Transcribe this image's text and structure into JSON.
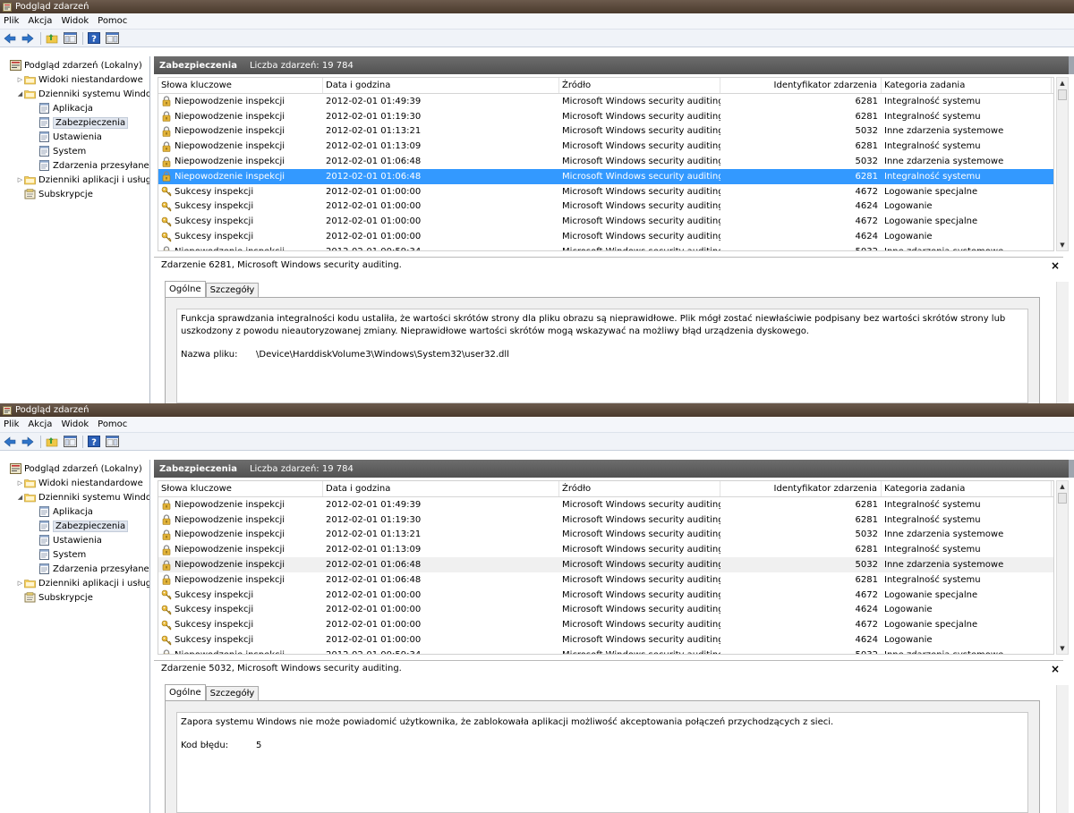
{
  "windows": [
    {
      "title": "Podgląd zdarzeń",
      "menu": [
        "Plik",
        "Akcja",
        "Widok",
        "Pomoc"
      ],
      "tree": [
        {
          "label": "Podgląd zdarzeń (Lokalny)",
          "twist": "",
          "level": 0,
          "icon": "event-viewer-icon"
        },
        {
          "label": "Widoki niestandardowe",
          "twist": "▷",
          "level": 1,
          "icon": "folder-icon"
        },
        {
          "label": "Dzienniki systemu Windows",
          "twist": "◢",
          "level": 1,
          "icon": "folder-icon"
        },
        {
          "label": "Aplikacja",
          "twist": "",
          "level": 2,
          "icon": "log-icon"
        },
        {
          "label": "Zabezpieczenia",
          "twist": "",
          "level": 2,
          "icon": "log-icon",
          "selected": true
        },
        {
          "label": "Ustawienia",
          "twist": "",
          "level": 2,
          "icon": "log-icon"
        },
        {
          "label": "System",
          "twist": "",
          "level": 2,
          "icon": "log-icon"
        },
        {
          "label": "Zdarzenia przesyłane dalej",
          "twist": "",
          "level": 2,
          "icon": "log-icon"
        },
        {
          "label": "Dzienniki aplikacji i usług",
          "twist": "▷",
          "level": 1,
          "icon": "folder-icon"
        },
        {
          "label": "Subskrypcje",
          "twist": "",
          "level": 1,
          "icon": "subscription-icon"
        }
      ],
      "header": {
        "title": "Zabezpieczenia",
        "count": "Liczba zdarzeń: 19 784"
      },
      "columns": [
        "Słowa kluczowe",
        "Data i godzina",
        "Źródło",
        "Identyfikator zdarzenia",
        "Kategoria zadania"
      ],
      "rows": [
        {
          "icon": "lock-icon",
          "keyword": "Niepowodzenie inspekcji",
          "date": "2012-02-01 01:49:39",
          "source": "Microsoft Windows security auditing.",
          "id": "6281",
          "category": "Integralność systemu"
        },
        {
          "icon": "lock-icon",
          "keyword": "Niepowodzenie inspekcji",
          "date": "2012-02-01 01:19:30",
          "source": "Microsoft Windows security auditing.",
          "id": "6281",
          "category": "Integralność systemu"
        },
        {
          "icon": "lock-icon",
          "keyword": "Niepowodzenie inspekcji",
          "date": "2012-02-01 01:13:21",
          "source": "Microsoft Windows security auditing.",
          "id": "5032",
          "category": "Inne zdarzenia systemowe"
        },
        {
          "icon": "lock-icon",
          "keyword": "Niepowodzenie inspekcji",
          "date": "2012-02-01 01:13:09",
          "source": "Microsoft Windows security auditing.",
          "id": "6281",
          "category": "Integralność systemu"
        },
        {
          "icon": "lock-icon",
          "keyword": "Niepowodzenie inspekcji",
          "date": "2012-02-01 01:06:48",
          "source": "Microsoft Windows security auditing.",
          "id": "5032",
          "category": "Inne zdarzenia systemowe"
        },
        {
          "icon": "lock-icon",
          "keyword": "Niepowodzenie inspekcji",
          "date": "2012-02-01 01:06:48",
          "source": "Microsoft Windows security auditing.",
          "id": "6281",
          "category": "Integralność systemu",
          "selected": true
        },
        {
          "icon": "key-icon",
          "keyword": "Sukcesy inspekcji",
          "date": "2012-02-01 01:00:00",
          "source": "Microsoft Windows security auditing.",
          "id": "4672",
          "category": "Logowanie specjalne"
        },
        {
          "icon": "key-icon",
          "keyword": "Sukcesy inspekcji",
          "date": "2012-02-01 01:00:00",
          "source": "Microsoft Windows security auditing.",
          "id": "4624",
          "category": "Logowanie"
        },
        {
          "icon": "key-icon",
          "keyword": "Sukcesy inspekcji",
          "date": "2012-02-01 01:00:00",
          "source": "Microsoft Windows security auditing.",
          "id": "4672",
          "category": "Logowanie specjalne"
        },
        {
          "icon": "key-icon",
          "keyword": "Sukcesy inspekcji",
          "date": "2012-02-01 01:00:00",
          "source": "Microsoft Windows security auditing.",
          "id": "4624",
          "category": "Logowanie"
        },
        {
          "icon": "lock-icon",
          "keyword": "Niepowodzenie inspekcji",
          "date": "2012-02-01 00:59:34",
          "source": "Microsoft Windows security auditing.",
          "id": "5032",
          "category": "Inne zdarzenia systemowe"
        }
      ],
      "detail": {
        "title": "Zdarzenie 6281, Microsoft Windows security auditing.",
        "close": "×",
        "tabs": [
          "Ogólne",
          "Szczegóły"
        ],
        "text": "Funkcja sprawdzania integralności kodu ustaliła, że wartości skrótów strony dla pliku obrazu są nieprawidłowe. Plik mógł zostać niewłaściwie podpisany bez wartości skrótów strony lub uszkodzony z powodu nieautoryzowanej zmiany. Nieprawidłowe wartości skrótów mogą wskazywać na możliwy błąd urządzenia dyskowego.",
        "field_label": "Nazwa pliku:",
        "field_value": "\\Device\\HarddiskVolume3\\Windows\\System32\\user32.dll"
      }
    },
    {
      "title": "Podgląd zdarzeń",
      "menu": [
        "Plik",
        "Akcja",
        "Widok",
        "Pomoc"
      ],
      "tree": [
        {
          "label": "Podgląd zdarzeń (Lokalny)",
          "twist": "",
          "level": 0,
          "icon": "event-viewer-icon"
        },
        {
          "label": "Widoki niestandardowe",
          "twist": "▷",
          "level": 1,
          "icon": "folder-icon"
        },
        {
          "label": "Dzienniki systemu Windows",
          "twist": "◢",
          "level": 1,
          "icon": "folder-icon"
        },
        {
          "label": "Aplikacja",
          "twist": "",
          "level": 2,
          "icon": "log-icon"
        },
        {
          "label": "Zabezpieczenia",
          "twist": "",
          "level": 2,
          "icon": "log-icon",
          "selected": true
        },
        {
          "label": "Ustawienia",
          "twist": "",
          "level": 2,
          "icon": "log-icon"
        },
        {
          "label": "System",
          "twist": "",
          "level": 2,
          "icon": "log-icon"
        },
        {
          "label": "Zdarzenia przesyłane dalej",
          "twist": "",
          "level": 2,
          "icon": "log-icon"
        },
        {
          "label": "Dzienniki aplikacji i usług",
          "twist": "▷",
          "level": 1,
          "icon": "folder-icon"
        },
        {
          "label": "Subskrypcje",
          "twist": "",
          "level": 1,
          "icon": "subscription-icon"
        }
      ],
      "header": {
        "title": "Zabezpieczenia",
        "count": "Liczba zdarzeń: 19 784"
      },
      "columns": [
        "Słowa kluczowe",
        "Data i godzina",
        "Źródło",
        "Identyfikator zdarzenia",
        "Kategoria zadania"
      ],
      "rows": [
        {
          "icon": "lock-icon",
          "keyword": "Niepowodzenie inspekcji",
          "date": "2012-02-01 01:49:39",
          "source": "Microsoft Windows security auditing.",
          "id": "6281",
          "category": "Integralność systemu"
        },
        {
          "icon": "lock-icon",
          "keyword": "Niepowodzenie inspekcji",
          "date": "2012-02-01 01:19:30",
          "source": "Microsoft Windows security auditing.",
          "id": "6281",
          "category": "Integralność systemu"
        },
        {
          "icon": "lock-icon",
          "keyword": "Niepowodzenie inspekcji",
          "date": "2012-02-01 01:13:21",
          "source": "Microsoft Windows security auditing.",
          "id": "5032",
          "category": "Inne zdarzenia systemowe"
        },
        {
          "icon": "lock-icon",
          "keyword": "Niepowodzenie inspekcji",
          "date": "2012-02-01 01:13:09",
          "source": "Microsoft Windows security auditing.",
          "id": "6281",
          "category": "Integralność systemu"
        },
        {
          "icon": "lock-icon",
          "keyword": "Niepowodzenie inspekcji",
          "date": "2012-02-01 01:06:48",
          "source": "Microsoft Windows security auditing.",
          "id": "5032",
          "category": "Inne zdarzenia systemowe",
          "highlighted": true
        },
        {
          "icon": "lock-icon",
          "keyword": "Niepowodzenie inspekcji",
          "date": "2012-02-01 01:06:48",
          "source": "Microsoft Windows security auditing.",
          "id": "6281",
          "category": "Integralność systemu"
        },
        {
          "icon": "key-icon",
          "keyword": "Sukcesy inspekcji",
          "date": "2012-02-01 01:00:00",
          "source": "Microsoft Windows security auditing.",
          "id": "4672",
          "category": "Logowanie specjalne"
        },
        {
          "icon": "key-icon",
          "keyword": "Sukcesy inspekcji",
          "date": "2012-02-01 01:00:00",
          "source": "Microsoft Windows security auditing.",
          "id": "4624",
          "category": "Logowanie"
        },
        {
          "icon": "key-icon",
          "keyword": "Sukcesy inspekcji",
          "date": "2012-02-01 01:00:00",
          "source": "Microsoft Windows security auditing.",
          "id": "4672",
          "category": "Logowanie specjalne"
        },
        {
          "icon": "key-icon",
          "keyword": "Sukcesy inspekcji",
          "date": "2012-02-01 01:00:00",
          "source": "Microsoft Windows security auditing.",
          "id": "4624",
          "category": "Logowanie"
        },
        {
          "icon": "lock-icon",
          "keyword": "Niepowodzenie inspekcji",
          "date": "2012-02-01 00:59:34",
          "source": "Microsoft Windows security auditing.",
          "id": "5032",
          "category": "Inne zdarzenia systemowe"
        }
      ],
      "detail": {
        "title": "Zdarzenie 5032, Microsoft Windows security auditing.",
        "close": "×",
        "tabs": [
          "Ogólne",
          "Szczegóły"
        ],
        "text": "Zapora systemu Windows nie może powiadomić użytkownika, że zablokowała aplikacji możliwość akceptowania połączeń przychodzących z sieci.",
        "field_label": "Kod błędu:",
        "field_value": "5"
      }
    }
  ],
  "colors": {
    "selection": "#3399ff",
    "header_bar": "#5e5e5e",
    "titlebar": "#5a4a3c"
  }
}
